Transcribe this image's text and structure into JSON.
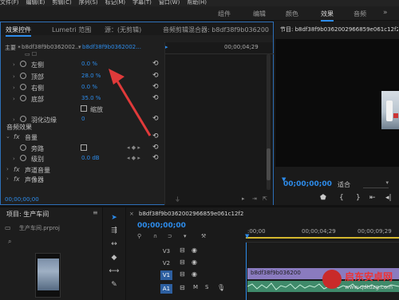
{
  "menubar": {
    "items": [
      "文件(F)",
      "编辑(E)",
      "剪辑(C)",
      "序列(S)",
      "标记(M)",
      "字幕(T)",
      "窗口(W)",
      "帮助(H)"
    ]
  },
  "workspaces": {
    "items": [
      "组件",
      "编辑",
      "颜色",
      "效果",
      "音频"
    ],
    "active": "效果"
  },
  "effects_panel": {
    "tabs": [
      "效果控件",
      "Lumetri 范围",
      "源：(无剪辑)",
      "音频剪辑混合器: b8df38f9b036200"
    ],
    "master_label": "主要 *",
    "master_clip": "b8df38f9b0362002...",
    "seq_clip": "b8df38f9b0362002...",
    "rows": [
      {
        "label": "左侧",
        "value": "0.0 %"
      },
      {
        "label": "顶部",
        "value": "28.0 %"
      },
      {
        "label": "右侧",
        "value": "0.0 %"
      },
      {
        "label": "底部",
        "value": "35.0 %"
      }
    ],
    "zoom_label": "缩放",
    "feather_label": "羽化边缘",
    "feather_value": "0",
    "audio_section": "音频效果",
    "volume_label": "音量",
    "bypass_label": "旁路",
    "level_label": "级别",
    "level_value": "0.0 dB",
    "channel_volume_label": "声道音量",
    "panner_label": "声像器",
    "timecode": "00;00;00;00"
  },
  "program_monitor": {
    "title": "节目: b8df38f9b0362002966859e061c12f2",
    "timecode": "00;00;00;00",
    "fit": "适合"
  },
  "project_panel": {
    "title": "项目: 生产车间",
    "file": "生产车间.prproj"
  },
  "timeline": {
    "tab": "b8df38f9b0362002966859e061c12f2",
    "timecode": "00;00;00;00",
    "ruler": [
      ":00;00",
      "00;00;04;29",
      "00;00;09;29"
    ],
    "tracks": [
      "V3",
      "V2",
      "V1",
      "A1"
    ],
    "clip_label": "b8df38f9b036200"
  },
  "watermark": {
    "line1": "启东安卓网",
    "line2": "www.qdtdzg.com"
  },
  "colors": {
    "accent": "#2d8ceb",
    "arrow": "#e03a3a"
  }
}
